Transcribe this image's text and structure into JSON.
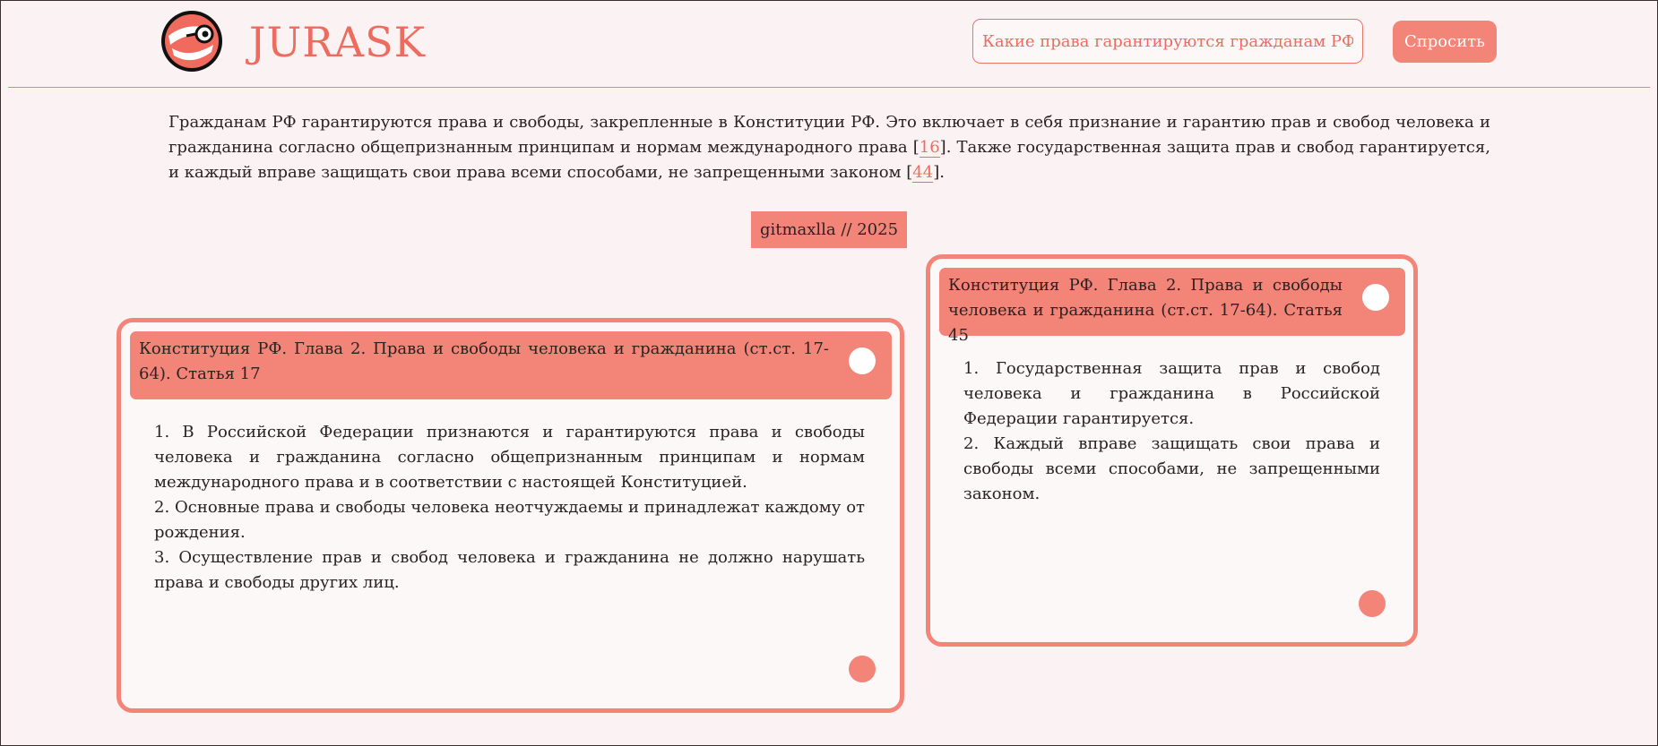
{
  "header": {
    "brand": "JURASK",
    "search": {
      "value": "Какие права гарантируются гражданам РФ?",
      "placeholder": "Какие права гарантируются гражданам РФ?"
    },
    "ask_label": "Спросить"
  },
  "answer": {
    "text_1": "Гражданам РФ гарантируются права и свободы, закрепленные в Конституции РФ. Это включает в себя признание и гарантию прав и свобод человека и гражданина согласно общепризнанным принципам и нормам международного права [",
    "ref_1": "16",
    "text_2": "]. Также государственная защита прав и свобод гарантируется, и каждый вправе защищать свои права всеми способами, не запрещенными законом [",
    "ref_2": "44",
    "text_3": "]."
  },
  "credit": "gitmaxlla // 2025",
  "sources": [
    {
      "title": "Конституция РФ. Глава 2. Права и свободы человека и гражданина (ст.ст. 17-64). Статья 17",
      "paragraphs": [
        "1. В Российской Федерации признаются и гарантируются права и свободы человека и гражданина согласно общепризнанным принципам и нормам международного права и в соответствии с настоящей Конституцией.",
        "2. Основные права и свободы человека неотчуждаемы и принадлежат каждому от рождения.",
        "3. Осуществление прав и свобод человека и гражданина не должно нарушать права и свободы других лиц."
      ]
    },
    {
      "title": "Конституция РФ. Глава 2. Права и свободы человека и гражданина (ст.ст. 17-64). Статья 45",
      "paragraphs": [
        "1. Государственная защита прав и свобод человека и гражданина в Российской Федерации гарантируется.",
        "2. Каждый вправе защищать свои права и свободы всеми способами, не запрещенными законом."
      ]
    }
  ],
  "colors": {
    "accent": "#f38478",
    "brand": "#ec6c5f",
    "background": "#fbf3f3"
  },
  "icons": {
    "logo": "bird-with-glasses-logo-icon"
  }
}
